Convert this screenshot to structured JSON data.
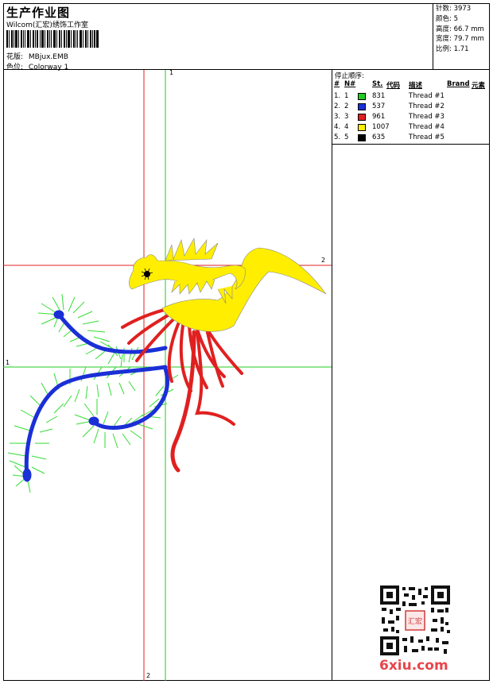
{
  "header": {
    "title": "生产作业图",
    "company": "Wilcom(汇宏)绣饰工作室",
    "file_label": "花版:",
    "file_name": "MBjux.EMB",
    "colorway_label": "色位:",
    "colorway": "Colorway 1"
  },
  "stats": [
    {
      "label": "针数:",
      "value": "3973"
    },
    {
      "label": "颜色:",
      "value": "5"
    },
    {
      "label": "高度:",
      "value": "66.7 mm"
    },
    {
      "label": "宽度:",
      "value": "79.7 mm"
    },
    {
      "label": "比例:",
      "value": "1.71"
    }
  ],
  "stop_sequence": {
    "title": "停止顺序:",
    "headers": {
      "num": "#",
      "n": "N#",
      "st": "St.",
      "code": "代码",
      "desc": "描述",
      "brand": "Brand",
      "element": "元素"
    },
    "rows": [
      {
        "num": "1.",
        "n": "1",
        "color": "#22cc22",
        "st": "831",
        "desc": "Thread #1"
      },
      {
        "num": "2.",
        "n": "2",
        "color": "#1a2fd6",
        "st": "537",
        "desc": "Thread #2"
      },
      {
        "num": "3.",
        "n": "3",
        "color": "#e02020",
        "st": "961",
        "desc": "Thread #3"
      },
      {
        "num": "4.",
        "n": "4",
        "color": "#ffee00",
        "st": "1007",
        "desc": "Thread #4"
      },
      {
        "num": "5.",
        "n": "5",
        "color": "#000000",
        "st": "635",
        "desc": "Thread #5"
      }
    ]
  },
  "axes": {
    "top": "1",
    "bottom": "2",
    "left": "1",
    "right": "2"
  },
  "watermark": "6xiu.com",
  "qr_badge": "汇宏"
}
